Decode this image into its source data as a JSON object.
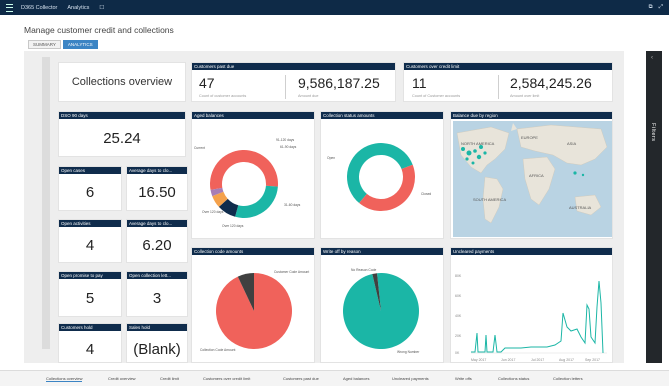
{
  "topbar": {
    "app": "D365 Collector",
    "crumb": "Analytics",
    "pin": "☐",
    "icon1": "⧉",
    "icon2": "⤢"
  },
  "page": {
    "title": "Manage customer credit and collections",
    "tabs": [
      "SUMMARY",
      "ANALYTICS"
    ]
  },
  "filters_label": "Filters",
  "overview_title": "Collections overview",
  "customers_past_due": {
    "header": "Customers past due",
    "count": "47",
    "count_label": "Count of customer accounts",
    "amount": "9,586,187.25",
    "amount_label": "Amount due"
  },
  "customers_over_limit": {
    "header": "Customers over credit limit",
    "count": "11",
    "count_label": "Count of Customer accounts",
    "amount": "2,584,245.26",
    "amount_label": "Amount over limit"
  },
  "dso": {
    "header": "DSO 90 days",
    "value": "25.24"
  },
  "open_cases": {
    "header": "Open cases",
    "value": "6"
  },
  "avg_days_case": {
    "header": "Average days to clo...",
    "value": "16.50"
  },
  "open_activities": {
    "header": "Open activities",
    "value": "4"
  },
  "avg_days_activity": {
    "header": "Average days to clo...",
    "value": "6.20"
  },
  "open_promise": {
    "header": "Open promise to pay",
    "value": "5"
  },
  "open_collection_letters": {
    "header": "Open collection lett...",
    "value": "3"
  },
  "customers_hold": {
    "header": "Customers hold",
    "value": "4"
  },
  "sales_hold": {
    "header": "Sales hold",
    "value": "(Blank)"
  },
  "aged_balances": {
    "header": "Aged balances",
    "labels": [
      "91-120 days",
      "61-90 days",
      "Current",
      "31-60 days",
      "Over 120 days"
    ]
  },
  "collection_agents": {
    "header": "Collection status amounts",
    "labels": [
      "Open",
      "Closed"
    ]
  },
  "map": {
    "header": "Balance due by region",
    "labels": [
      "NORTH AMERICA",
      "EUROPE",
      "ASIA",
      "AFRICA",
      "SOUTH AMERICA",
      "AUSTRALIA"
    ]
  },
  "code_amounts": {
    "header": "Collection code amounts",
    "labels": [
      "Customer Code Amount",
      "Collection Code Amount"
    ]
  },
  "write_off": {
    "header": "Write off by reason",
    "labels": [
      "No Reason Code",
      "Wrong Number"
    ]
  },
  "payments": {
    "header": "Uncleared payments",
    "yticks": [
      "80K",
      "60K",
      "40K",
      "20K",
      "0K"
    ],
    "xticks": [
      "May 2017",
      "Jun 2017",
      "Jul 2017",
      "Aug 2017",
      "Sep 2017"
    ]
  },
  "bottom_tabs": [
    "Collections overview",
    "Credit overview",
    "Credit limit",
    "Customers over credit limit",
    "Customers past due",
    "Aged balances",
    "Uncleared payments",
    "Write offs",
    "Collections status",
    "Collection letters"
  ],
  "colors": {
    "navy": "#0f2c4c",
    "teal": "#1bb6a6",
    "coral": "#f0625b",
    "purple": "#a77db5",
    "dark": "#404040",
    "orange": "#f4a14b"
  },
  "chart_data": [
    {
      "type": "pie",
      "title": "Aged balances",
      "labels": [
        "Current",
        "91-120 days",
        "61-90 days",
        "31-60 days",
        "Over 120 days"
      ],
      "values": [
        0.54,
        0.28,
        0.09,
        0.06,
        0.03
      ]
    },
    {
      "type": "pie",
      "title": "Collection status amounts",
      "labels": [
        "Open",
        "Closed"
      ],
      "values": [
        0.58,
        0.42
      ]
    },
    {
      "type": "pie",
      "title": "Collection code amounts",
      "labels": [
        "Customer Code Amount",
        "Collection Code Amount"
      ],
      "values": [
        0.93,
        0.07
      ]
    },
    {
      "type": "pie",
      "title": "Write off by reason",
      "labels": [
        "No Reason Code",
        "Wrong Number"
      ],
      "values": [
        0.98,
        0.02
      ]
    },
    {
      "type": "line",
      "title": "Uncleared payments",
      "x": [
        "May 2017",
        "Jun 2017",
        "Jul 2017",
        "Aug 2017",
        "Sep 2017"
      ],
      "ylim": [
        0,
        80000
      ]
    }
  ]
}
